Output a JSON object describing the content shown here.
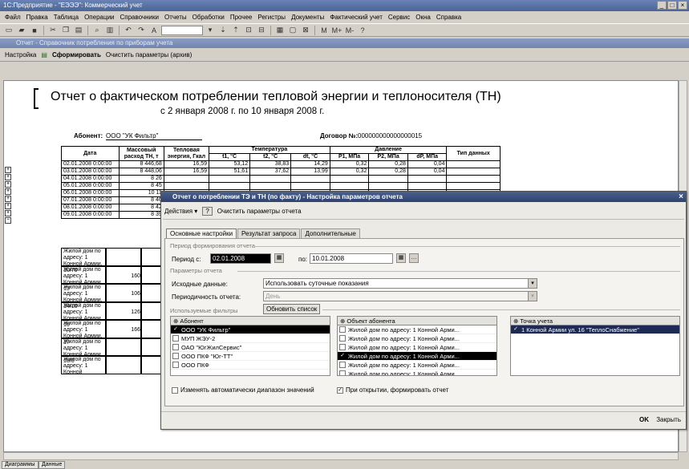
{
  "app": {
    "title": "1С:Предприятие - \"ЕЭЭЭ\": Коммерческий учет",
    "window_buttons": [
      "_",
      "□",
      "×"
    ]
  },
  "menu": [
    "Файл",
    "Правка",
    "Таблица",
    "Операции",
    "Справочники",
    "Отчеты",
    "Обработки",
    "Прочее",
    "Регистры",
    "Документы",
    "Фактический учет",
    "Сервис",
    "Окна",
    "Справка"
  ],
  "child_window": {
    "title": "Отчет - Справочник потребления по приборам учета",
    "toolbar": {
      "settings": "Настройка",
      "generate": "Сформировать",
      "clear": "Очистить параметры (архив)"
    }
  },
  "report": {
    "title": "Отчет о фактическом потреблении тепловой энергии и теплоносителя (ТН)",
    "subtitle": "с 2 января 2008 г. по 10 января 2008 г.",
    "subscriber_label": "Абонент:",
    "subscriber_value": "ООО \"УК Фильтр\"",
    "contract_label": "Договор №:",
    "contract_value": "000000000000000015",
    "columns": {
      "date": "Дата",
      "mass": "Массовый расход ТН, т",
      "heat": "Тепловая энергия, Гкал",
      "temp": "Температура",
      "t1": "t1, °C",
      "t2": "t2, °C",
      "dt": "dt, °C",
      "pressure": "Давление",
      "p1": "P1, МПа",
      "p2": "P2, МПа",
      "dp": "dP, МПа",
      "type": "Тип данных"
    },
    "rows": [
      {
        "date": "02.01.2008 0:00:00",
        "mass": "8 446,68",
        "heat": "16,59",
        "t1": "53,12",
        "t2": "38,83",
        "dt": "14,29",
        "p1": "0,32",
        "p2": "0,28",
        "dp": "0,04"
      },
      {
        "date": "03.01.2008 0:00:00",
        "mass": "8 448,06",
        "heat": "16,59",
        "t1": "51,61",
        "t2": "37,62",
        "dt": "13,99",
        "p1": "0,32",
        "p2": "0,28",
        "dp": "0,04"
      },
      {
        "date": "04.01.2008 0:00:00",
        "mass": "8 26"
      },
      {
        "date": "05.01.2008 0:00:00",
        "mass": "8 45"
      },
      {
        "date": "06.01.2008 0:00:00",
        "mass": "10 11"
      },
      {
        "date": "07.01.2008 0:00:00",
        "mass": "8 46"
      },
      {
        "date": "08.01.2008 0:00:00",
        "mass": "8 42"
      },
      {
        "date": "09.01.2008 0:00:00",
        "mass": "8 39"
      }
    ],
    "address_rows": [
      {
        "text": "Жилой дом по адресу: 1 Конной Армии, 10/70",
        "value": ""
      },
      {
        "text": "Жилой дом по адресу: 1 Конной Армии, 13",
        "value": "160"
      },
      {
        "text": "Жилой дом по адресу: 1 Конной Армии, 14/10",
        "value": "106"
      },
      {
        "text": "Жилой дом по адресу: 1 Конной Армии, 16",
        "value": "126"
      },
      {
        "text": "Жилой дом по адресу: 1 Конной Армии, 17",
        "value": "166"
      },
      {
        "text": "Жилой дом по адресу: 1 Конной Армии, 18/8",
        "value": ""
      },
      {
        "text": "Жилой дом по адресу: 1 Конной",
        "value": ""
      }
    ]
  },
  "dialog": {
    "title": "Отчет о потреблении ТЭ и ТН (по факту) - Настройка параметров отчета",
    "close": "×",
    "toolbar": {
      "actions": "Действия",
      "help": "?",
      "clear": "Очистить параметры отчета"
    },
    "tabs": [
      "Основные настройки",
      "Результат запроса",
      "Дополнительные"
    ],
    "period_section": "Период формирования отчета",
    "period_from_label": "Период с:",
    "period_from_value": "02.01.2008",
    "period_to_label": "по:",
    "period_to_value": "10.01.2008",
    "params_section": "Параметры отчета",
    "source_label": "Исходные данные:",
    "source_value": "Использовать суточные показания",
    "freq_label": "Периодичность отчета:",
    "freq_value": "День",
    "filters_section": "Используемые фильтры",
    "refresh_button": "Обновить список",
    "subscribers_header": "Абонент",
    "subscribers": [
      {
        "name": "ООО \"УК Фильтр\"",
        "checked": true
      },
      {
        "name": "МУП ЖЭУ-2",
        "checked": false
      },
      {
        "name": "ОАО \"ЮгЖилСервис\"",
        "checked": false
      },
      {
        "name": "ООО ПКФ \"Юг-ТТ\"",
        "checked": false
      },
      {
        "name": "ООО ПКФ",
        "checked": false
      }
    ],
    "objects_header": "Объект абонента",
    "objects": [
      {
        "name": "Жилой дом по адресу: 1 Конной Арми...",
        "checked": false
      },
      {
        "name": "Жилой дом по адресу: 1 Конной Арми...",
        "checked": false
      },
      {
        "name": "Жилой дом по адресу: 1 Конной Арми...",
        "checked": false
      },
      {
        "name": "Жилой дом по адресу: 1 Конной Арми...",
        "checked": true
      },
      {
        "name": "Жилой дом по адресу: 1 Конной Арми...",
        "checked": false
      },
      {
        "name": "Жилой дом по адресу: 1 Конной Арми...",
        "checked": false
      }
    ],
    "points_header": "Точка учета",
    "points": [
      {
        "name": "1 Конной Армии ул. 16 \"ТеплоСнабжение\"",
        "checked": true
      }
    ],
    "auto_range_label": "Изменять автоматически диапазон значений",
    "auto_range_checked": false,
    "on_open_label": "При открытии, формировать отчет",
    "on_open_checked": true,
    "ok_button": "OK",
    "close_button": "Закрыть"
  },
  "status_tabs": [
    "Диаграммы",
    "Данные"
  ]
}
